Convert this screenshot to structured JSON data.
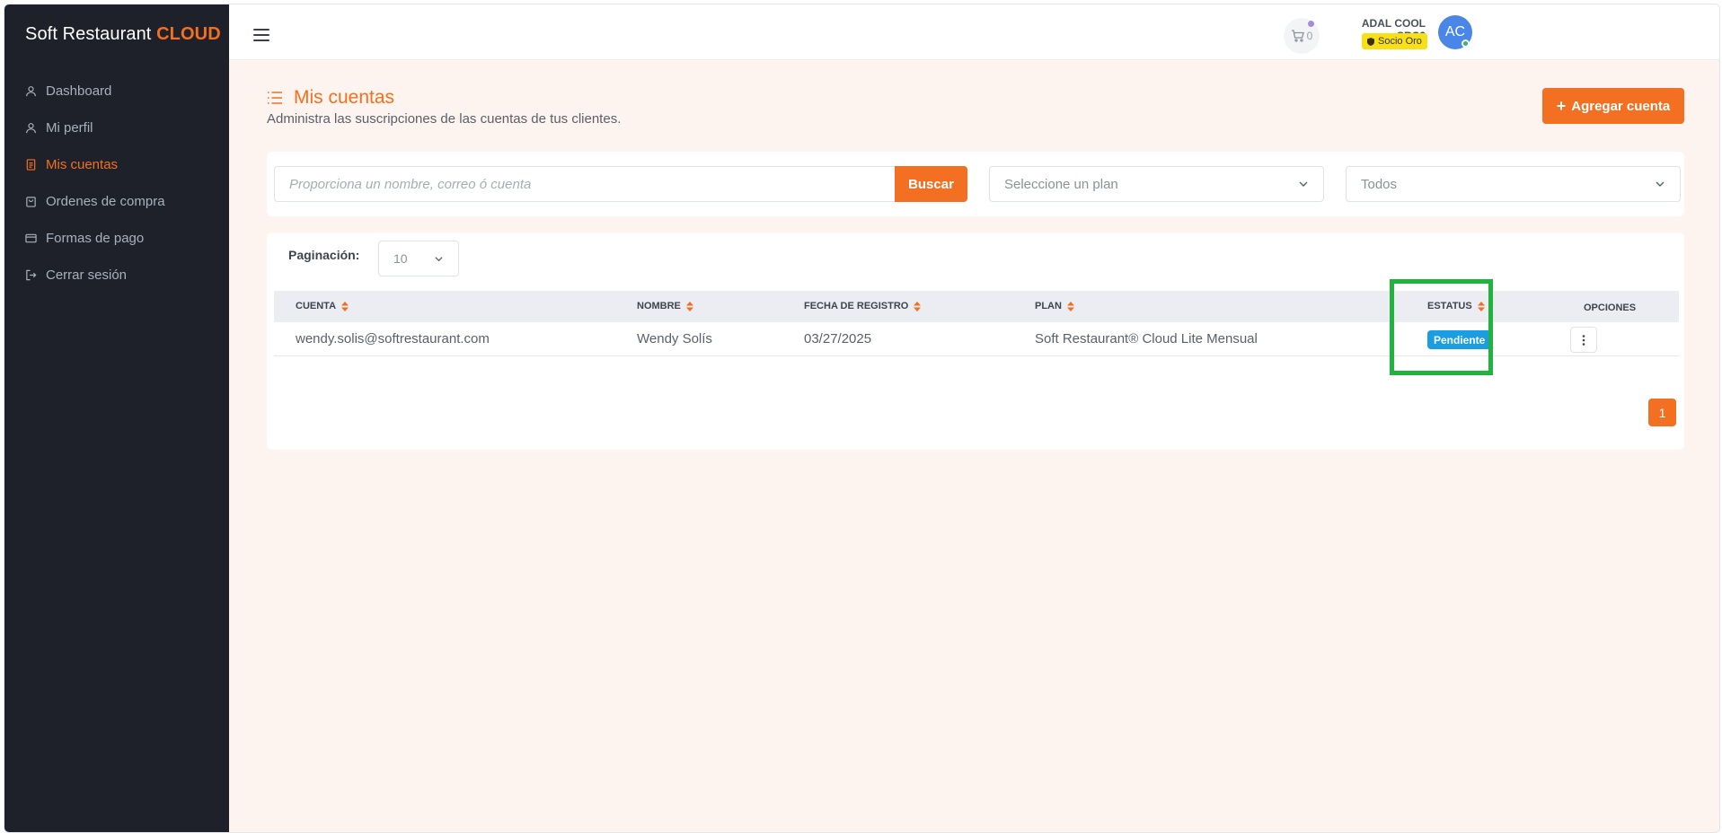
{
  "brand": {
    "name": "Soft Restaurant",
    "accent": "CLOUD"
  },
  "sidebar": {
    "items": [
      {
        "label": "Dashboard",
        "icon": "user-icon",
        "active": false
      },
      {
        "label": "Mi perfil",
        "icon": "user-icon",
        "active": false
      },
      {
        "label": "Mis cuentas",
        "icon": "document-icon",
        "active": true
      },
      {
        "label": "Ordenes de compra",
        "icon": "bag-icon",
        "active": false
      },
      {
        "label": "Formas de pago",
        "icon": "card-icon",
        "active": false
      },
      {
        "label": "Cerrar sesión",
        "icon": "logout-icon",
        "active": false
      }
    ]
  },
  "topbar": {
    "cart_count": "0",
    "user_name": "ADAL COOL SRC2",
    "user_badge": "Socio Oro",
    "avatar_initials": "AC"
  },
  "page": {
    "title": "Mis cuentas",
    "subtitle": "Administra las suscripciones de las cuentas de tus clientes.",
    "add_button": "Agregar cuenta"
  },
  "filters": {
    "search_placeholder": "Proporciona un nombre, correo ó cuenta",
    "search_button": "Buscar",
    "plan_select": "Seleccione un plan",
    "status_select": "Todos"
  },
  "table": {
    "pagination_label": "Paginación:",
    "page_size": "10",
    "columns": {
      "cuenta": "CUENTA",
      "nombre": "NOMBRE",
      "fecha": "FECHA DE REGISTRO",
      "plan": "PLAN",
      "estatus": "ESTATUS",
      "opciones": "OPCIONES"
    },
    "rows": [
      {
        "cuenta": "wendy.solis@softrestaurant.com",
        "nombre": "Wendy Solís",
        "fecha": "03/27/2025",
        "plan": "Soft Restaurant® Cloud Lite Mensual",
        "estatus": "Pendiente"
      }
    ],
    "current_page": "1"
  },
  "colors": {
    "accent": "#f36f21",
    "sidebar_bg": "#1e2129",
    "status_pending": "#1b9de2",
    "highlight": "#22b33e"
  }
}
